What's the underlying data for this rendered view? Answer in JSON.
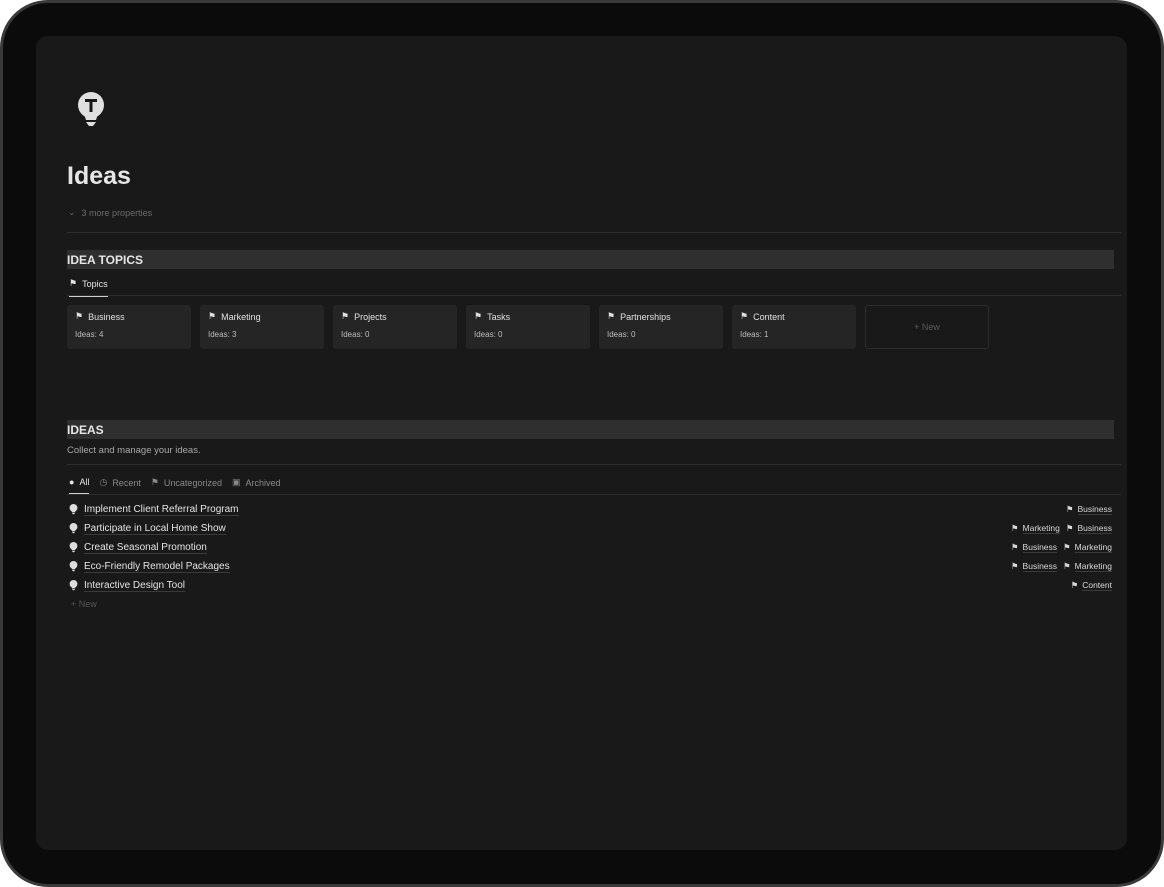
{
  "page": {
    "title": "Ideas",
    "more_properties": "3 more properties"
  },
  "topics_section": {
    "heading": "IDEA TOPICS",
    "tab": "Topics",
    "cards": [
      {
        "name": "Business",
        "count": "Ideas: 4"
      },
      {
        "name": "Marketing",
        "count": "Ideas: 3"
      },
      {
        "name": "Projects",
        "count": "Ideas: 0"
      },
      {
        "name": "Tasks",
        "count": "Ideas: 0"
      },
      {
        "name": "Partnerships",
        "count": "Ideas: 0"
      },
      {
        "name": "Content",
        "count": "Ideas: 1"
      }
    ],
    "new_label": "+ New"
  },
  "ideas_section": {
    "heading": "IDEAS",
    "description": "Collect and manage your ideas.",
    "tabs": [
      "All",
      "Recent",
      "Uncategorized",
      "Archived"
    ],
    "rows": [
      {
        "name": "Implement Client Referral Program",
        "tags": [
          "Business"
        ]
      },
      {
        "name": "Participate in Local Home Show",
        "tags": [
          "Marketing",
          "Business"
        ]
      },
      {
        "name": "Create Seasonal Promotion",
        "tags": [
          "Business",
          "Marketing"
        ]
      },
      {
        "name": "Eco-Friendly Remodel Packages",
        "tags": [
          "Business",
          "Marketing"
        ]
      },
      {
        "name": "Interactive Design Tool",
        "tags": [
          "Content"
        ]
      }
    ],
    "new_label": "+ New"
  }
}
